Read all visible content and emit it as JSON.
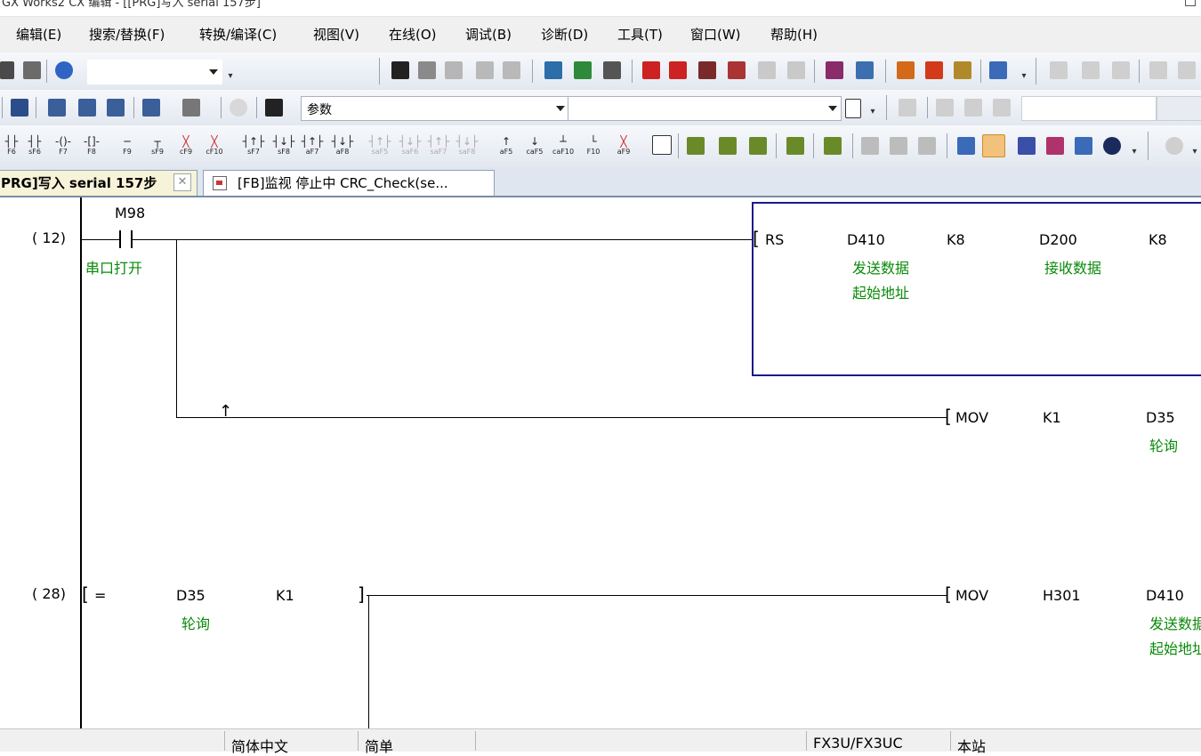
{
  "window": {
    "title": "GX Works2 CX 编辑 - [[PRG]写入 serial 157步]"
  },
  "menu": [
    "编辑(E)",
    "搜索/替换(F)",
    "转换/编译(C)",
    "视图(V)",
    "在线(O)",
    "调试(B)",
    "诊断(D)",
    "工具(T)",
    "窗口(W)",
    "帮助(H)"
  ],
  "toolbar2": {
    "combo_value": "参数"
  },
  "fkeys": [
    {
      "g": "┤├",
      "l": "F6"
    },
    {
      "g": "┤├",
      "l": "sF6"
    },
    {
      "g": "-()-",
      "l": "F7"
    },
    {
      "g": "-[]-",
      "l": "F8"
    },
    {
      "g": "─",
      "l": "F9"
    },
    {
      "g": "┬",
      "l": "sF9"
    },
    {
      "g": "╳",
      "l": "cF9"
    },
    {
      "g": "╳",
      "l": "cF10"
    },
    {
      "g": "┤↑├",
      "l": "sF7"
    },
    {
      "g": "┤↓├",
      "l": "sF8"
    },
    {
      "g": "┤↑├",
      "l": "aF7"
    },
    {
      "g": "┤↓├",
      "l": "aF8"
    },
    {
      "g": "┤↑├",
      "l": "saF5"
    },
    {
      "g": "┤↓├",
      "l": "saF6"
    },
    {
      "g": "┤↑├",
      "l": "saF7"
    },
    {
      "g": "┤↓├",
      "l": "saF8"
    },
    {
      "g": "↑",
      "l": "aF5"
    },
    {
      "g": "↓",
      "l": "caF5"
    },
    {
      "g": "┴",
      "l": "caF10"
    },
    {
      "g": "└",
      "l": "F10"
    },
    {
      "g": "╳",
      "l": "aF9"
    }
  ],
  "tabs": [
    {
      "label": "PRG]写入 serial 157步",
      "active": true
    },
    {
      "label": "[FB]监视 停止中 CRC_Check(se...",
      "active": false
    }
  ],
  "ladder": {
    "rung1": {
      "step": "( 12)",
      "contact_device": "M98",
      "contact_comment": "串口打开",
      "rs": {
        "op": "RS",
        "p1": "D410",
        "p1_comment1": "发送数据",
        "p1_comment2": "起始地址",
        "p2": "K8",
        "p3": "D200",
        "p3_comment": "接收数据",
        "p4": "K8"
      },
      "mov": {
        "op": "MOV",
        "src": "K1",
        "dst": "D35",
        "dst_comment": "轮询"
      }
    },
    "rung2": {
      "step": "( 28)",
      "cmp_op": "=",
      "cmp_a": "D35",
      "cmp_a_comment": "轮询",
      "cmp_b": "K1",
      "mov": {
        "op": "MOV",
        "src": "H301",
        "dst": "D410",
        "dst_comment1": "发送数据",
        "dst_comment2": "起始地址"
      }
    }
  },
  "status": {
    "language": "简体中文",
    "mode": "简单",
    "plc": "FX3U/FX3UC",
    "station": "本站"
  },
  "colors": {
    "comment": "#0a8a0a",
    "highlight_box": "#1a1a8c"
  }
}
